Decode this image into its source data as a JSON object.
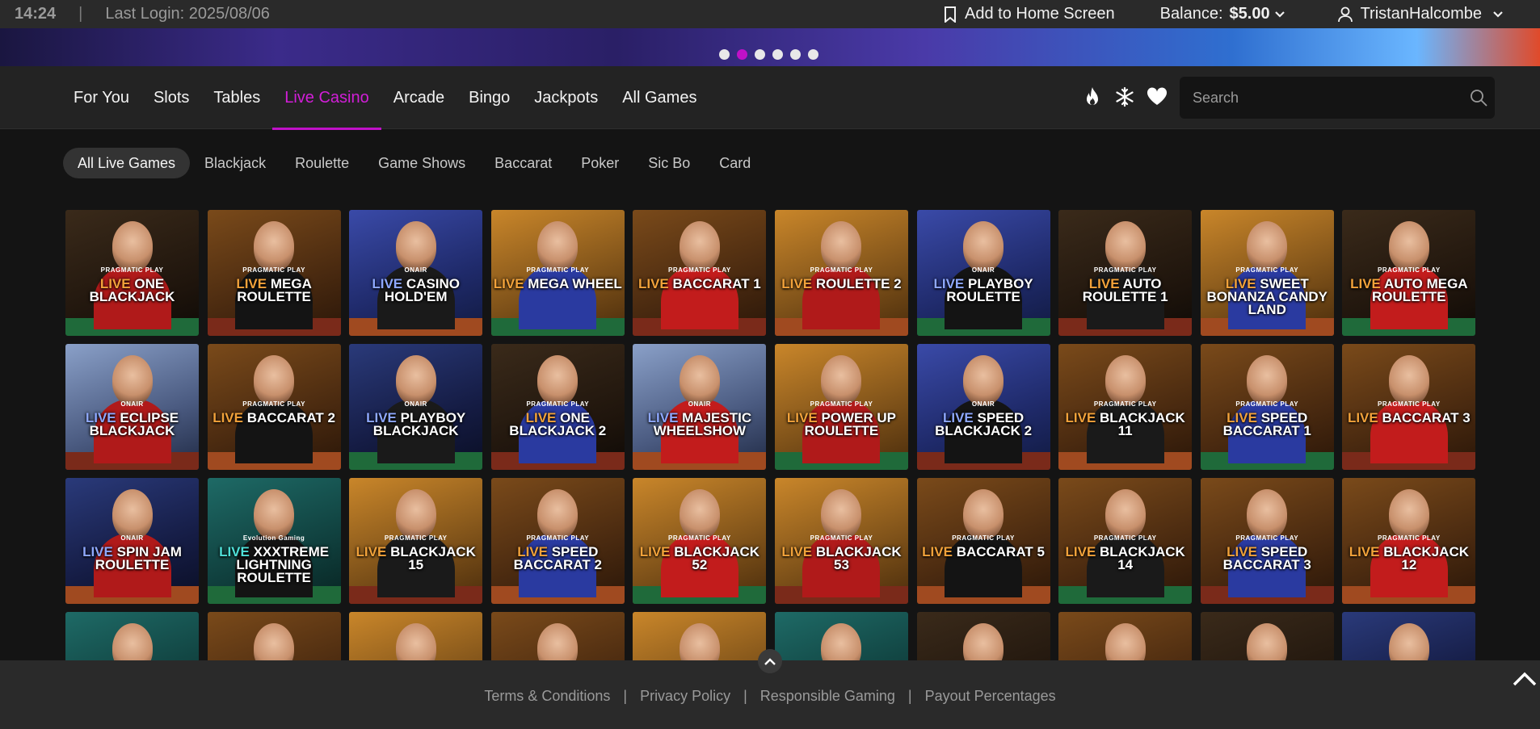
{
  "topbar": {
    "time": "14:24",
    "separator": "|",
    "last_login": "Last Login: 2025/08/06",
    "add_home": "Add to Home Screen",
    "balance_label": "Balance:",
    "balance_value": "$5.00",
    "username": "TristanHalcombe"
  },
  "banner": {
    "slide_count": 6,
    "active_index": 1
  },
  "nav": {
    "tabs": [
      "For You",
      "Slots",
      "Tables",
      "Live Casino",
      "Arcade",
      "Bingo",
      "Jackpots",
      "All Games"
    ],
    "active": "Live Casino",
    "search_placeholder": "Search"
  },
  "subnav": {
    "chips": [
      "All Live Games",
      "Blackjack",
      "Roulette",
      "Game Shows",
      "Baccarat",
      "Poker",
      "Sic Bo",
      "Card"
    ],
    "active": "All Live Games"
  },
  "games": [
    {
      "live": "LIVE",
      "name": "ONE BLACKJACK",
      "brand": "PRAGMATIC PLAY",
      "theme": "t-dark",
      "live_color": "live"
    },
    {
      "live": "LIVE",
      "name": "MEGA ROULETTE",
      "brand": "PRAGMATIC PLAY",
      "theme": "t-amber",
      "live_color": "live"
    },
    {
      "live": "LIVE",
      "name": "CASINO HOLD'EM",
      "brand": "ONAIR",
      "theme": "t-blue",
      "live_color": "live blue"
    },
    {
      "live": "LIVE",
      "name": "MEGA WHEEL",
      "brand": "PRAGMATIC PLAY",
      "theme": "t-gold",
      "live_color": "live"
    },
    {
      "live": "LIVE",
      "name": "BACCARAT 1",
      "brand": "PRAGMATIC PLAY",
      "theme": "t-amber",
      "live_color": "live"
    },
    {
      "live": "LIVE",
      "name": "ROULETTE 2",
      "brand": "PRAGMATIC PLAY",
      "theme": "t-gold",
      "live_color": "live"
    },
    {
      "live": "LIVE",
      "name": "PLAYBOY ROULETTE",
      "brand": "ONAIR",
      "theme": "t-blue",
      "live_color": "live blue"
    },
    {
      "live": "LIVE",
      "name": "AUTO ROULETTE 1",
      "brand": "PRAGMATIC PLAY",
      "theme": "t-dark",
      "live_color": "live"
    },
    {
      "live": "LIVE",
      "name": "SWEET BONANZA CANDY LAND",
      "brand": "PRAGMATIC PLAY",
      "theme": "t-gold",
      "live_color": "live"
    },
    {
      "live": "LIVE",
      "name": "AUTO MEGA ROULETTE",
      "brand": "PRAGMATIC PLAY",
      "theme": "t-dark",
      "live_color": "live"
    },
    {
      "live": "LIVE",
      "name": "ECLIPSE BLACKJACK",
      "brand": "ONAIR",
      "theme": "t-silver",
      "live_color": "live blue"
    },
    {
      "live": "LIVE",
      "name": "BACCARAT 2",
      "brand": "PRAGMATIC PLAY",
      "theme": "t-amber",
      "live_color": "live"
    },
    {
      "live": "LIVE",
      "name": "PLAYBOY BLACKJACK",
      "brand": "ONAIR",
      "theme": "t-night",
      "live_color": "live blue"
    },
    {
      "live": "LIVE",
      "name": "ONE BLACKJACK 2",
      "brand": "PRAGMATIC PLAY",
      "theme": "t-dark",
      "live_color": "live"
    },
    {
      "live": "LIVE",
      "name": "MAJESTIC WHEELSHOW",
      "brand": "ONAIR",
      "theme": "t-silver",
      "live_color": "live blue"
    },
    {
      "live": "LIVE",
      "name": "POWER UP ROULETTE",
      "brand": "PRAGMATIC PLAY",
      "theme": "t-gold",
      "live_color": "live"
    },
    {
      "live": "LIVE",
      "name": "SPEED BLACKJACK 2",
      "brand": "ONAIR",
      "theme": "t-blue",
      "live_color": "live blue"
    },
    {
      "live": "LIVE",
      "name": "BLACKJACK 11",
      "brand": "PRAGMATIC PLAY",
      "theme": "t-amber",
      "live_color": "live"
    },
    {
      "live": "LIVE",
      "name": "SPEED BACCARAT 1",
      "brand": "PRAGMATIC PLAY",
      "theme": "t-amber",
      "live_color": "live"
    },
    {
      "live": "LIVE",
      "name": "BACCARAT 3",
      "brand": "PRAGMATIC PLAY",
      "theme": "t-amber",
      "live_color": "live"
    },
    {
      "live": "LIVE",
      "name": "SPIN JAM ROULETTE",
      "brand": "ONAIR",
      "theme": "t-night",
      "live_color": "live blue"
    },
    {
      "live": "LIVE",
      "name": "XXXTREME LIGHTNING ROULETTE",
      "brand": "Evolution Gaming",
      "theme": "t-teal",
      "live_color": "live cyan"
    },
    {
      "live": "LIVE",
      "name": "BLACKJACK 15",
      "brand": "PRAGMATIC PLAY",
      "theme": "t-gold",
      "live_color": "live"
    },
    {
      "live": "LIVE",
      "name": "SPEED BACCARAT 2",
      "brand": "PRAGMATIC PLAY",
      "theme": "t-amber",
      "live_color": "live"
    },
    {
      "live": "LIVE",
      "name": "BLACKJACK 52",
      "brand": "PRAGMATIC PLAY",
      "theme": "t-gold",
      "live_color": "live"
    },
    {
      "live": "LIVE",
      "name": "BLACKJACK 53",
      "brand": "PRAGMATIC PLAY",
      "theme": "t-gold",
      "live_color": "live"
    },
    {
      "live": "LIVE",
      "name": "BACCARAT 5",
      "brand": "PRAGMATIC PLAY",
      "theme": "t-amber",
      "live_color": "live"
    },
    {
      "live": "LIVE",
      "name": "BLACKJACK 14",
      "brand": "PRAGMATIC PLAY",
      "theme": "t-amber",
      "live_color": "live"
    },
    {
      "live": "LIVE",
      "name": "SPEED BACCARAT 3",
      "brand": "PRAGMATIC PLAY",
      "theme": "t-amber",
      "live_color": "live"
    },
    {
      "live": "LIVE",
      "name": "BLACKJACK 12",
      "brand": "PRAGMATIC PLAY",
      "theme": "t-amber",
      "live_color": "live"
    },
    {
      "live": "",
      "name": "",
      "brand": "",
      "theme": "t-teal",
      "live_color": "live"
    },
    {
      "live": "",
      "name": "",
      "brand": "",
      "theme": "t-amber",
      "live_color": "live"
    },
    {
      "live": "",
      "name": "",
      "brand": "",
      "theme": "t-gold",
      "live_color": "live"
    },
    {
      "live": "",
      "name": "",
      "brand": "",
      "theme": "t-amber",
      "live_color": "live"
    },
    {
      "live": "",
      "name": "",
      "brand": "",
      "theme": "t-gold",
      "live_color": "live"
    },
    {
      "live": "",
      "name": "",
      "brand": "",
      "theme": "t-teal",
      "live_color": "live"
    },
    {
      "live": "",
      "name": "",
      "brand": "",
      "theme": "t-dark",
      "live_color": "live"
    },
    {
      "live": "",
      "name": "",
      "brand": "",
      "theme": "t-amber",
      "live_color": "live"
    },
    {
      "live": "",
      "name": "",
      "brand": "",
      "theme": "t-dark",
      "live_color": "live"
    },
    {
      "live": "",
      "name": "",
      "brand": "",
      "theme": "t-night",
      "live_color": "live"
    }
  ],
  "footer": {
    "links": [
      "Terms & Conditions",
      "Privacy Policy",
      "Responsible Gaming",
      "Payout Percentages"
    ],
    "separator": "|"
  },
  "colors": {
    "accent": "#c011c8",
    "topbar_bg": "#2a2a2a",
    "nav_bg": "#232323",
    "page_bg": "#141414"
  },
  "icons": {
    "add_home": "bookmark-icon",
    "balance": "chevron-down-icon",
    "user": "user-icon",
    "hot": "flame-icon",
    "new": "snowflake-icon",
    "favorites": "heart-icon",
    "search": "search-icon",
    "collapse": "chevron-up-icon",
    "back_to_top": "chevron-up-icon"
  }
}
